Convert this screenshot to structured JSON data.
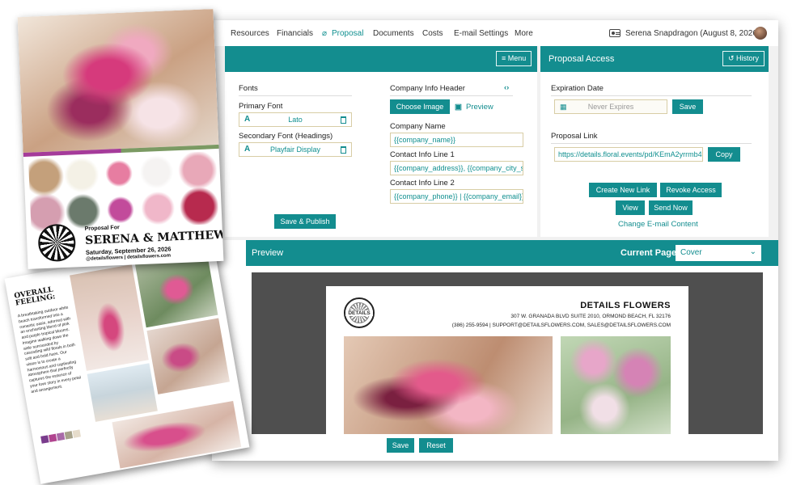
{
  "nav": {
    "items": [
      "Resources",
      "Financials",
      "Proposal",
      "Documents",
      "Costs",
      "E-mail Settings",
      "More"
    ],
    "active": "Proposal",
    "user": "Serena Snapdragon (August 8, 2026)"
  },
  "design_panel": {
    "menu_label": "Menu",
    "fonts_heading": "Fonts",
    "primary_font_label": "Primary Font",
    "primary_font_value": "Lato",
    "secondary_font_label": "Secondary Font (Headings)",
    "secondary_font_value": "Playfair Display",
    "company_header_label": "Company Info Header",
    "choose_image_label": "Choose Image",
    "preview_label": "Preview",
    "company_name_label": "Company Name",
    "company_name_value": "{{company_name}}",
    "contact1_label": "Contact Info Line 1",
    "contact1_value": "{{company_address}}, {{company_city_stat",
    "contact2_label": "Contact Info Line 2",
    "contact2_value": "{{company_phone}} | {{company_email}}",
    "save_publish_label": "Save & Publish"
  },
  "access_panel": {
    "title": "Proposal Access",
    "history_label": "History",
    "expiration_label": "Expiration Date",
    "expiration_placeholder": "Never Expires",
    "save_label": "Save",
    "link_label": "Proposal Link",
    "link_value": "https://details.floral.events/pd/KEmA2yrrmb4",
    "copy_label": "Copy",
    "create_link_label": "Create New Link",
    "revoke_label": "Revoke Access",
    "view_label": "View",
    "send_now_label": "Send Now",
    "change_email_label": "Change E-mail Content"
  },
  "preview_panel": {
    "title": "Preview",
    "current_page_label": "Current Page:",
    "current_page_value": "Cover",
    "doc_company": "DETAILS FLOWERS",
    "doc_address": "307 W. GRANADA BLVD SUITE 2010, ORMOND BEACH, FL 32176",
    "doc_contact": "(386) 255-9594 | SUPPORT@DETAILSFLOWERS.COM, SALES@DETAILSFLOWERS.COM",
    "doc_logo_text": "DETAILS",
    "save_label": "Save",
    "reset_label": "Reset"
  },
  "flyer_cover": {
    "proposal_for": "Proposal For",
    "couple": "SERENA & MATTHEW",
    "date": "Saturday, September 26, 2026",
    "handle": "@detailsflowers | detailsflowers.com"
  },
  "flyer_inside": {
    "heading": "OVERALL FEELING:",
    "body": "A breathtaking outdoor white beach transformed into a romantic oasis, adorned with an enchanting blend of pink and purple tropical blooms. Imagine walking down the aisle surrounded by cascading wild florals in both soft and bold hues. Our vision is to create a harmonious and captivating atmosphere that perfectly captures the essence of your love story in every petal and arrangement.",
    "swatch_colors": [
      "#7a3c8c",
      "#b0448f",
      "#a86aa8",
      "#a7a28a",
      "#e6dccb"
    ]
  },
  "colors": {
    "teal": "#138d8f",
    "field_border": "#d8cda5",
    "preview_bg": "#4f4f4f"
  }
}
